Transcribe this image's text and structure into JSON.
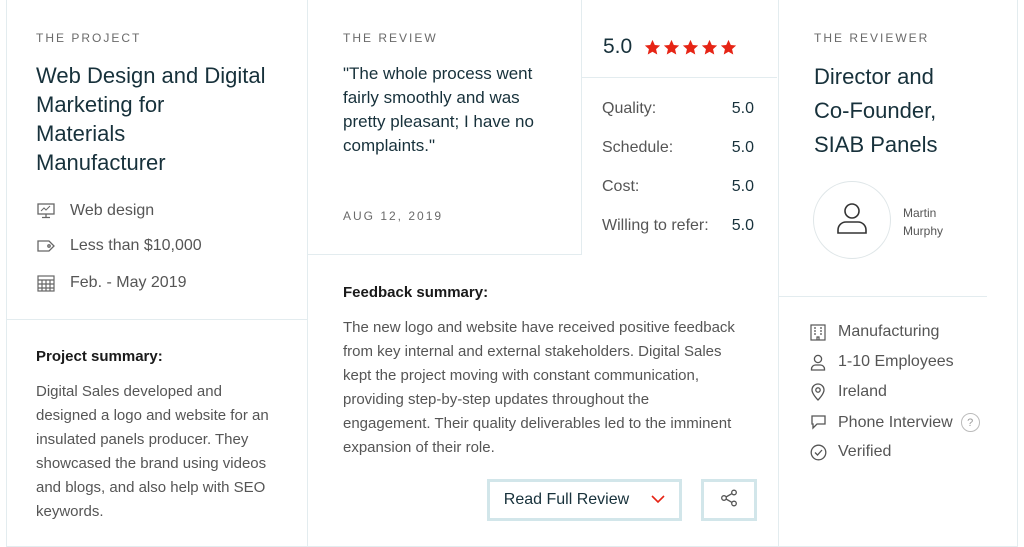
{
  "project": {
    "eyebrow": "THE PROJECT",
    "title_lines": [
      "Web Design and Digital",
      "Marketing for",
      "Materials",
      "Manufacturer"
    ],
    "meta": [
      {
        "icon": "monitor-icon",
        "label": "Web design"
      },
      {
        "icon": "price-tag-icon",
        "label": "Less than $10,000"
      },
      {
        "icon": "calendar-icon",
        "label": "Feb. - May 2019"
      }
    ],
    "summary_heading": "Project summary:",
    "summary_text": "Digital Sales developed and designed a logo and website for an insulated panels producer. They showcased the brand using videos and blogs, and also help with SEO keywords."
  },
  "review": {
    "eyebrow": "THE REVIEW",
    "quote": "\"The whole process went fairly smoothly and was pretty pleasant; I have no complaints.\"",
    "date": "AUG 12, 2019",
    "overall_score": "5.0",
    "stars": 5,
    "star_color": "#e62415",
    "ratings": [
      {
        "label": "Quality:",
        "value": "5.0"
      },
      {
        "label": "Schedule:",
        "value": "5.0"
      },
      {
        "label": "Cost:",
        "value": "5.0"
      },
      {
        "label": "Willing to refer:",
        "value": "5.0"
      }
    ],
    "feedback_heading": "Feedback summary:",
    "feedback_text": "The new logo and website have received positive feedback from key internal and external stakeholders. Digital Sales kept the project moving with constant communication, providing step-by-step updates throughout the engagement. Their quality deliverables led to the imminent expansion of their role.",
    "read_full_label": "Read Full Review"
  },
  "reviewer": {
    "eyebrow": "THE REVIEWER",
    "title_lines": [
      "Director and",
      "Co-Founder,",
      "SIAB Panels"
    ],
    "name_first": "Martin",
    "name_last": "Murphy",
    "info": [
      {
        "icon": "building-icon",
        "label": "Manufacturing"
      },
      {
        "icon": "person-icon",
        "label": "1-10 Employees"
      },
      {
        "icon": "location-pin-icon",
        "label": "Ireland"
      },
      {
        "icon": "chat-bubble-icon",
        "label": "Phone Interview"
      },
      {
        "icon": "check-circle-icon",
        "label": "Verified"
      }
    ],
    "help_mark": "?"
  },
  "colors": {
    "accent_border": "#d2e6ea",
    "chevron": "#e62415",
    "divider": "#e3ecef"
  }
}
